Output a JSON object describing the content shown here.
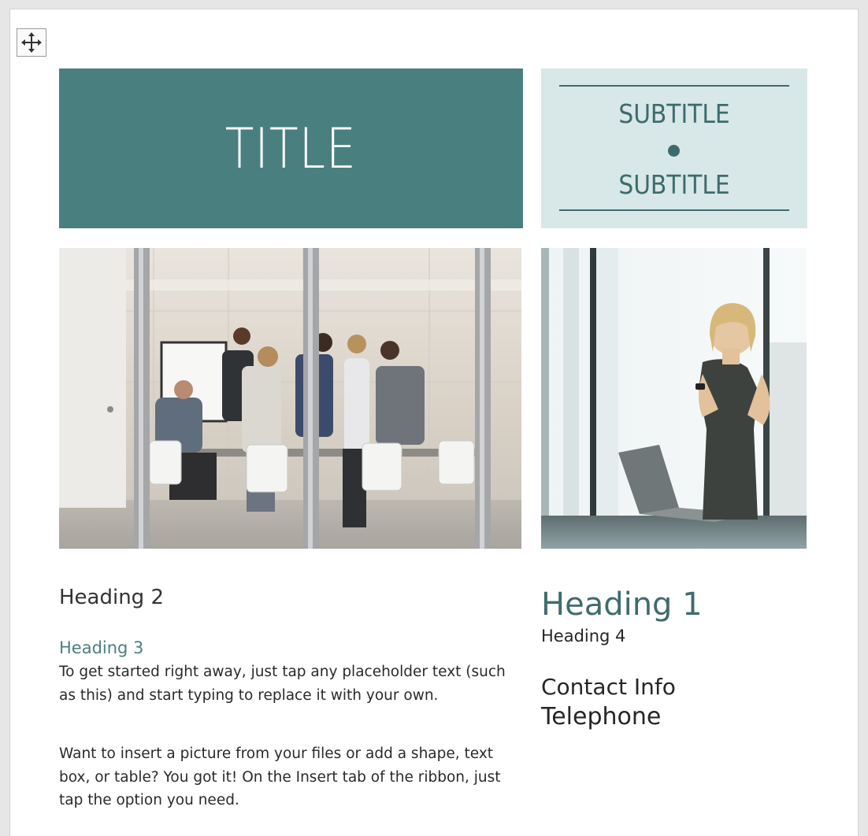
{
  "document": {
    "title": "TITLE",
    "subtitle_top": "SUBTITLE",
    "subtitle_bottom": "SUBTITLE",
    "heading_2": "Heading 2",
    "heading_3": "Heading 3",
    "paragraph_1": "To get started right away, just tap any placeholder text (such as this) and start typing to replace it with your own.",
    "paragraph_2": "Want to insert a picture from your files or add a shape, text box, or table? You got it! On the Insert tab of the ribbon, just tap the option you need.",
    "heading_1": "Heading 1",
    "heading_4": "Heading 4",
    "contact_info": "Contact Info",
    "telephone": "Telephone"
  },
  "icons": {
    "move_handle": "move-arrows-icon"
  },
  "colors": {
    "accent": "#4a7f80",
    "subtitle_background": "#d8e7e7",
    "subtitle_text": "#3d6b6c"
  }
}
